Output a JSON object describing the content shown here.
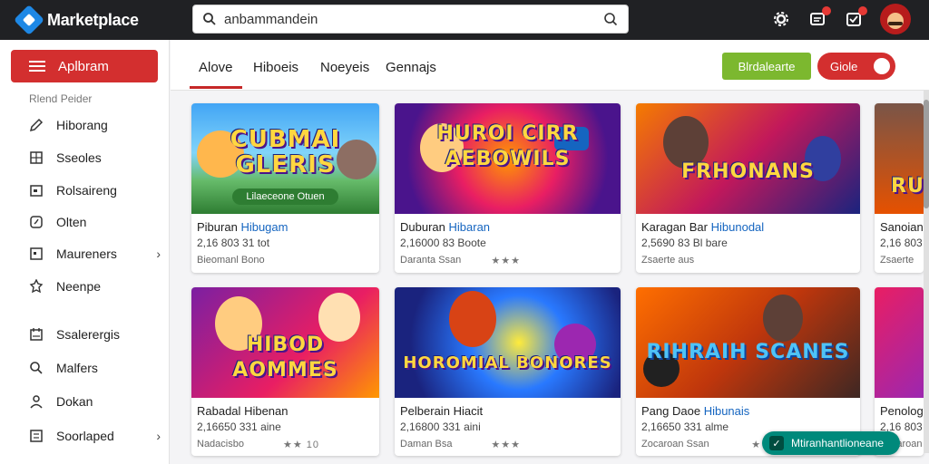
{
  "app": {
    "title": "Marketplace"
  },
  "search": {
    "value": "anbammandein",
    "placeholder": ""
  },
  "header_icons": [
    "settings-icon",
    "notifications-icon",
    "messages-icon",
    "avatar"
  ],
  "sidebar": {
    "primary_button": "Aplbram",
    "caption": "Rlend Peider",
    "items": [
      {
        "label": "Hiborang",
        "icon": "pen-icon"
      },
      {
        "label": "Sseoles",
        "icon": "grid-icon"
      },
      {
        "label": "Rolsaireng",
        "icon": "calendar-icon"
      },
      {
        "label": "Olten",
        "icon": "clock-icon"
      },
      {
        "label": "Maureners",
        "icon": "box-icon",
        "chevron": "›"
      },
      {
        "label": "Neenpe",
        "icon": "badge-icon"
      },
      {
        "label": "Ssalerergis",
        "icon": "calendar-icon"
      },
      {
        "label": "Malfers",
        "icon": "search-icon"
      },
      {
        "label": "Dokan",
        "icon": "user-icon"
      },
      {
        "label": "Soorlaped",
        "icon": "list-icon",
        "chevron": "›"
      }
    ]
  },
  "tabs": [
    {
      "label": "Alove",
      "active": true
    },
    {
      "label": "Hiboeis",
      "active": false
    },
    {
      "label": "Noeyeis",
      "active": false
    },
    {
      "label": "Gennajs",
      "active": false
    }
  ],
  "actions": {
    "green": "Blrdalearte",
    "red": "Giole"
  },
  "cards": [
    {
      "art_title": "CUBMAI GLERIS",
      "art_banner": "Lilaeceone Otuen",
      "name": "Piburan",
      "name_hl": "Hibugam",
      "meta": "2,16 803 31 tot",
      "foot": "Bieomanl Bono",
      "stars": ""
    },
    {
      "art_title": "HUROI CIRR AEBOWILS",
      "art_banner": "",
      "name": "Duburan",
      "name_hl": "Hibaran",
      "meta": "2,16000 83 Boote",
      "foot": "Daranta Ssan",
      "stars": "★★★"
    },
    {
      "art_title": "FRHONANS",
      "art_banner": "",
      "name": "Karagan Bar",
      "name_hl": "Hibunodal",
      "meta": "2,5690 83 Bl bare",
      "foot": "Zsaerte aus",
      "stars": ""
    },
    {
      "art_title": "RU",
      "art_banner": "",
      "name": "Sanoian",
      "name_hl": "",
      "meta": "2,16 803",
      "foot": "Zsaerte",
      "stars": ""
    },
    {
      "art_title": "HIBOD AOMMES",
      "art_banner": "",
      "name": "Rabadal",
      "name_hl": "Hibenan",
      "meta": "2,16650 331 aine",
      "foot": "Nadacisbo",
      "stars": "★★ 10"
    },
    {
      "art_title": "HOROMIAL BONORES",
      "art_banner": "",
      "name": "Pelberain",
      "name_hl": "Hiacit",
      "meta": "2,16800 331 aini",
      "foot": "Daman Bsa",
      "stars": "★★★"
    },
    {
      "art_title": "RIHRAIH SCANES",
      "art_banner": "",
      "name": "Pang Daoe",
      "name_hl": "Hibunais",
      "meta": "2,16650 331 alme",
      "foot": "Zocaroan Ssan",
      "stars": "★★"
    },
    {
      "art_title": "",
      "art_banner": "",
      "name": "Penologe",
      "name_hl": "",
      "meta": "2,16 803",
      "foot": "Zocaroan",
      "stars": ""
    }
  ],
  "toast": {
    "label": "Mtiranhantlioneane"
  },
  "colors": {
    "brand_red": "#d32f2f",
    "topbar": "#202124",
    "green": "#7cb82f",
    "toast": "#00897b"
  }
}
